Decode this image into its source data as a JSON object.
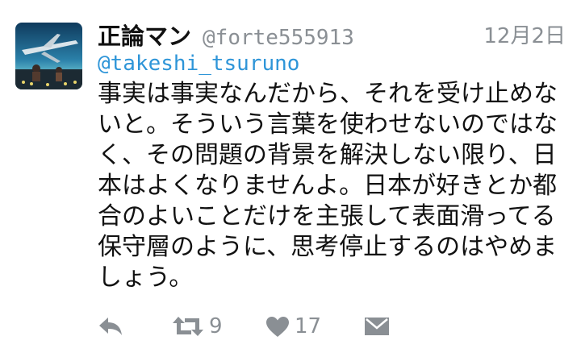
{
  "tweet": {
    "display_name": "正論マン",
    "handle": "@forte555913",
    "timestamp": "12月2日",
    "reply_to": "@takeshi_tsuruno",
    "body_lines": [
      "事実は事実なんだから、それを受け止めな",
      "いと。そういう言葉を使わせないのではな",
      "く、その問題の背景を解決しない限り、日",
      "本はよくなりませんよ。日本が好きとか都",
      "合のよいことだけを主張して表面滑ってる",
      "保守層のように、思考停止するのはやめま",
      "しょう。"
    ],
    "actions": {
      "reply_icon": "reply-icon",
      "retweet_icon": "retweet-icon",
      "retweet_count": "9",
      "like_icon": "heart-icon",
      "like_count": "17",
      "dm_icon": "envelope-icon"
    }
  },
  "colors": {
    "text": "#111111",
    "muted": "#8a8f94",
    "link": "#2e95d8",
    "background": "#ffffff"
  }
}
